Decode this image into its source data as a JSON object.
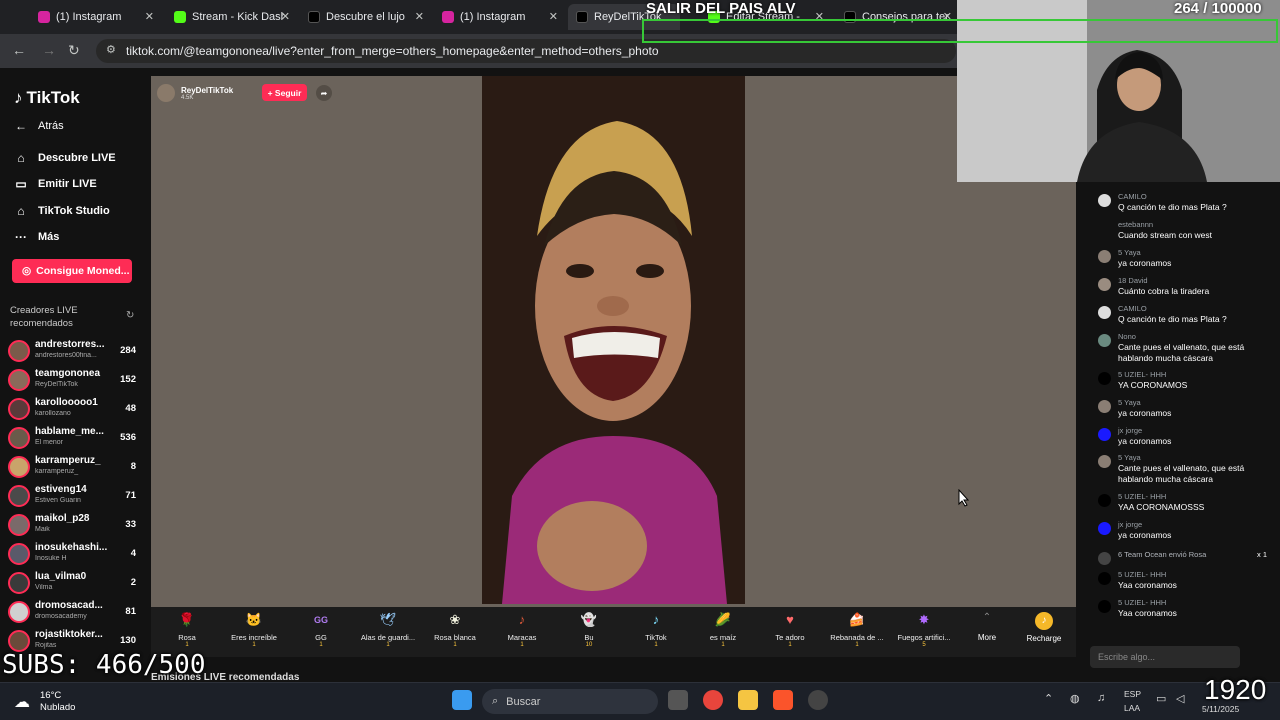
{
  "browser": {
    "tabs": [
      {
        "label": "(1) Instagram",
        "color": "#d6249f"
      },
      {
        "label": "Stream - Kick Dash",
        "color": "#53fc18"
      },
      {
        "label": "Descubre el lujo de",
        "color": "#000000"
      },
      {
        "label": "(1) Instagram",
        "color": "#d6249f"
      },
      {
        "label": "ReyDelTikTok",
        "color": "#000000"
      },
      {
        "label": "Editar Stream -",
        "color": "#53fc18"
      },
      {
        "label": "Consejos para ter",
        "color": "#000000"
      }
    ],
    "url": "tiktok.com/@teamgononea/live?enter_from_merge=others_homepage&enter_method=others_photo"
  },
  "sidebar": {
    "logo": "TikTok",
    "back": "Atrás",
    "nav": [
      {
        "label": "Descubre LIVE",
        "icon": "home-icon"
      },
      {
        "label": "Emitir LIVE",
        "icon": "camera-icon"
      },
      {
        "label": "TikTok Studio",
        "icon": "studio-icon"
      },
      {
        "label": "Más",
        "icon": "more-icon"
      }
    ],
    "coins_button": "Consigue Moned...",
    "section_title": "Creadores LIVE recomendados",
    "creators": [
      {
        "name": "andrestorres...",
        "sub": "andrestores00fina...",
        "count": "284"
      },
      {
        "name": "teamgononea",
        "sub": "ReyDelTikTok",
        "count": "152"
      },
      {
        "name": "karollooooo1",
        "sub": "karollozano",
        "count": "48"
      },
      {
        "name": "hablame_me...",
        "sub": "El menor",
        "count": "536"
      },
      {
        "name": "karramperuz_",
        "sub": "karramperuz_",
        "count": "8"
      },
      {
        "name": "estiveng14",
        "sub": "Estiven Guarin",
        "count": "71"
      },
      {
        "name": "maikol_p28",
        "sub": "Maik",
        "count": "33"
      },
      {
        "name": "inosukehashi...",
        "sub": "Inosuke H",
        "count": "4"
      },
      {
        "name": "lua_vilma0",
        "sub": "Vilma",
        "count": "2"
      },
      {
        "name": "dromosacad...",
        "sub": "dromosacademy",
        "count": "81"
      },
      {
        "name": "rojastiktoker...",
        "sub": "Rojitas",
        "count": "130"
      }
    ]
  },
  "live": {
    "host_name": "ReyDelTikTok",
    "host_sub": "4.5K",
    "follow": "+ Seguir",
    "recommended": "Emisiones LIVE recomendadas"
  },
  "gifts": [
    {
      "name": "Rosa",
      "price": "1",
      "icon": "🌹"
    },
    {
      "name": "Eres increíble",
      "price": "1",
      "icon": "🐱"
    },
    {
      "name": "GG",
      "price": "1",
      "icon": "GG"
    },
    {
      "name": "Alas de guardi...",
      "price": "1",
      "icon": "🕊"
    },
    {
      "name": "Rosa blanca",
      "price": "1",
      "icon": "❀"
    },
    {
      "name": "Maracas",
      "price": "1",
      "icon": "♪"
    },
    {
      "name": "Bu",
      "price": "10",
      "icon": "👻"
    },
    {
      "name": "TikTok",
      "price": "1",
      "icon": "♪"
    },
    {
      "name": "es maíz",
      "price": "1",
      "icon": "🌽"
    },
    {
      "name": "Te adoro",
      "price": "1",
      "icon": "♥"
    },
    {
      "name": "Rebanada de ...",
      "price": "1",
      "icon": "🍰"
    },
    {
      "name": "Fuegos artifici...",
      "price": "5",
      "icon": "✸"
    }
  ],
  "gift_more": "More",
  "gift_recharge": "Recharge",
  "chat": {
    "messages": [
      {
        "user": "CAMILO",
        "text": "Q canción te dio mas Plata ?",
        "color": "#777777"
      },
      {
        "user": "estebannn",
        "text": "Cuando stream con west",
        "color": "#121212"
      },
      {
        "user": "5 Yaya",
        "text": "ya coronamos",
        "color": "#8a7e74"
      },
      {
        "user": "18 David",
        "text": "Cuánto cobra la tiradera",
        "color": "#9a8c80"
      },
      {
        "user": "CAMILO",
        "text": "Q canción te dio mas Plata ?",
        "color": "#777777"
      },
      {
        "user": "Nono",
        "text": "Cante pues el vallenato, que está hablando mucha cáscara",
        "color": "#6a8a80"
      },
      {
        "user": "5 UZIEL- HHH",
        "text": "YA CORONAMOS",
        "color": "#000000"
      },
      {
        "user": "5 Yaya",
        "text": "ya coronamos",
        "color": "#8a7e74"
      },
      {
        "user": "jx jorge",
        "text": "ya coronamos",
        "color": "#1a1aff"
      },
      {
        "user": "5 Yaya",
        "text": "Cante pues el vallenato, que está hablando mucha cáscara",
        "color": "#8a7e74"
      },
      {
        "user": "5 UZIEL- HHH",
        "text": "YAA CORONAMOSSS",
        "color": "#000000"
      },
      {
        "user": "jx jorge",
        "text": "ya coronamos",
        "color": "#1a1aff"
      },
      {
        "user": "6 Team Ocean envió Rosa",
        "text": "",
        "color": "#444444"
      },
      {
        "user": "5 UZIEL- HHH",
        "text": "Yaa coronamos",
        "color": "#000000"
      },
      {
        "user": "5 UZIEL- HHH",
        "text": "Yaa coronamos",
        "color": "#000000"
      }
    ],
    "gift_x": "x 1",
    "input_placeholder": "Escribe algo..."
  },
  "overlay": {
    "title": "SALIR DEL PAIS ALV",
    "goal": "264  / 100000",
    "subs": "SUBS: 466/500",
    "big": "1920"
  },
  "taskbar": {
    "temp": "16°C",
    "weather": "Nublado",
    "search": "Buscar",
    "lang1": "ESP",
    "lang2": "LAA",
    "date": "5/11/2025"
  }
}
